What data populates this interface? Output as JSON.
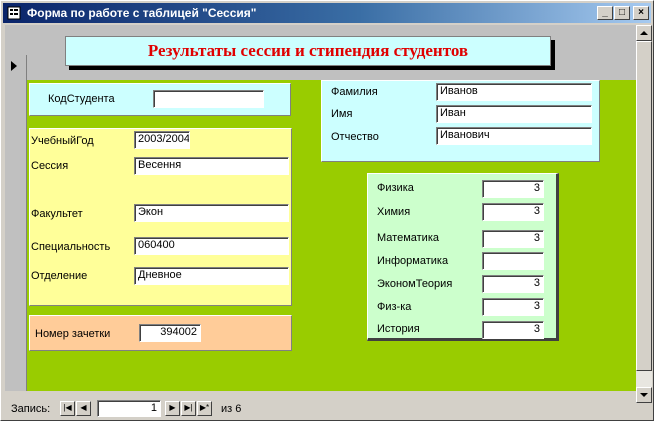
{
  "window": {
    "title": "Форма по работе с таблицей \"Сессия\"",
    "controls": {
      "minimize": "_",
      "maximize": "□",
      "close": "×"
    }
  },
  "banner": {
    "title": "Результаты сессии и стипендия студентов"
  },
  "student": {
    "id_label": "КодСтудента",
    "id_value": ""
  },
  "study": {
    "year_label": "УчебныйГод",
    "year_value": "2003/2004",
    "session_label": "Сессия",
    "session_value": "Весення",
    "faculty_label": "Факультет",
    "faculty_value": "Экон",
    "specialty_label": "Специальность",
    "specialty_value": "060400",
    "department_label": "Отделение",
    "department_value": "Дневное"
  },
  "record_book": {
    "label": "Номер зачетки",
    "value": "394002"
  },
  "person": {
    "surname_label": "Фамилия",
    "surname_value": "Иванов",
    "name_label": "Имя",
    "name_value": "Иван",
    "patronymic_label": "Отчество",
    "patronymic_value": "Иванович"
  },
  "grades": [
    {
      "subject": "Физика",
      "value": "3"
    },
    {
      "subject": "Химия",
      "value": "3"
    },
    {
      "subject": "Математика",
      "value": "3"
    },
    {
      "subject": "Информатика",
      "value": ""
    },
    {
      "subject": "ЭкономТеория",
      "value": "3"
    },
    {
      "subject": "Физ-ка",
      "value": "3"
    },
    {
      "subject": "История",
      "value": "3"
    }
  ],
  "navigation": {
    "record_label": "Запись:",
    "current": "1",
    "of_label": "из 6",
    "first": "|◀",
    "prev": "◀",
    "next": "▶",
    "last": "▶|",
    "new": "▶*"
  },
  "colors": {
    "form_background": "#99cc00",
    "banner_background": "#ccffff",
    "banner_text": "#e00000",
    "study_panel": "#ffff99",
    "record_book_panel": "#ffcc99",
    "grades_panel": "#ccffcc"
  },
  "icons": {
    "title": "form-icon",
    "record_selector": "current-record-arrow-icon"
  }
}
